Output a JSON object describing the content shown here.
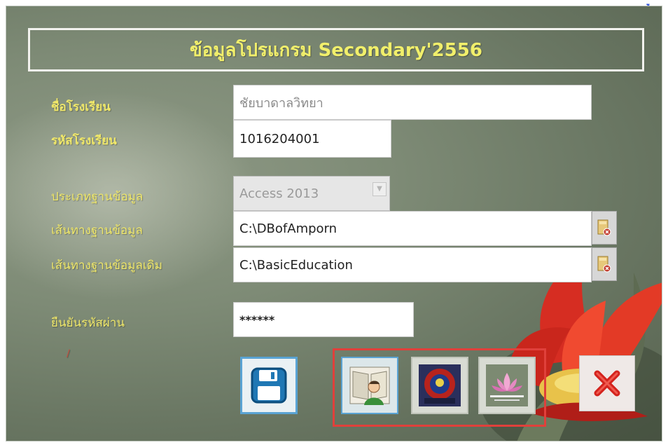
{
  "title": "ข้อมูลโปรแกรม Secondary'2556",
  "corner_glyph": "ู",
  "labels": {
    "school_name": "ชื่อโรงเรียน",
    "school_code": "รหัสโรงเรียน",
    "db_type": "ประเภทฐานข้อมูล",
    "db_path": "เส้นทางฐานข้อมูล",
    "db_path_old": "เส้นทางฐานข้อมูลเดิม",
    "confirm_password": "ยืนยันรหัสผ่าน",
    "small_mark": "/"
  },
  "fields": {
    "school_name": "ชัยบาดาลวิทยา",
    "school_code": "1016204001",
    "db_type": "Access 2013",
    "db_path": "C:\\DBofAmporn",
    "db_path_old": "C:\\BasicEducation",
    "confirm_password": "******"
  },
  "icons": {
    "save": "floppy-disk-icon",
    "teacher": "teacher-book-icon",
    "logo": "school-logo-icon",
    "lotus": "lotus-icon",
    "close": "close-x-icon",
    "browse": "folder-delete-icon"
  },
  "colors": {
    "label": "#f0e86a",
    "highlight_frame": "#e0403b",
    "close": "#d4231d"
  }
}
